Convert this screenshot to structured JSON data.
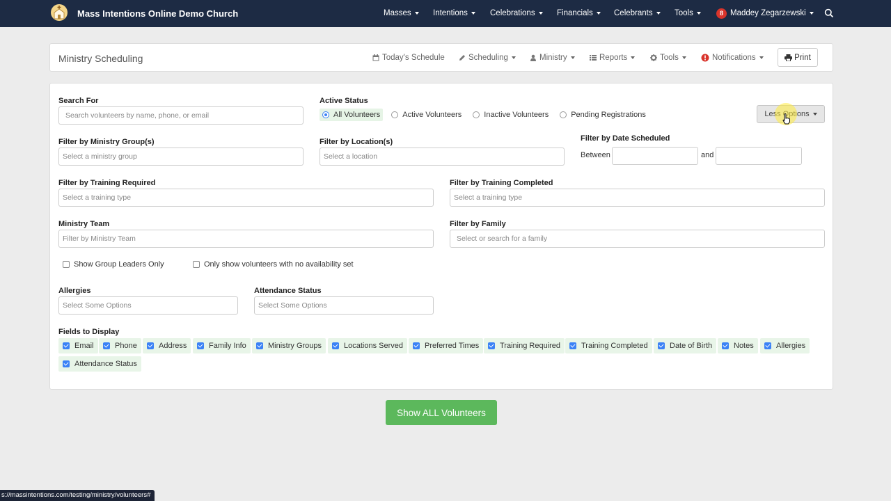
{
  "navbar": {
    "brand": "Mass Intentions Online Demo Church",
    "items": [
      {
        "label": "Masses"
      },
      {
        "label": "Intentions"
      },
      {
        "label": "Celebrations"
      },
      {
        "label": "Financials"
      },
      {
        "label": "Celebrants"
      },
      {
        "label": "Tools"
      }
    ],
    "notification_count": "8",
    "user_name": "Maddey Zegarzewski",
    "logo_icon": "church-logo-icon",
    "search_icon": "search-icon"
  },
  "header": {
    "title": "Ministry Scheduling",
    "menu": [
      {
        "label": "Today's Schedule",
        "icon": "calendar-icon"
      },
      {
        "label": "Scheduling",
        "icon": "pencil-icon"
      },
      {
        "label": "Ministry",
        "icon": "user-icon"
      },
      {
        "label": "Reports",
        "icon": "list-icon"
      },
      {
        "label": "Tools",
        "icon": "gear-icon"
      },
      {
        "label": "Notifications",
        "icon": "alert-icon"
      }
    ],
    "print_label": "Print"
  },
  "filters": {
    "search": {
      "label": "Search For",
      "placeholder": "Search volunteers by name, phone, or email"
    },
    "active_status": {
      "label": "Active Status",
      "options": [
        "All Volunteers",
        "Active Volunteers",
        "Inactive Volunteers",
        "Pending Registrations"
      ],
      "selected": "All Volunteers"
    },
    "less_options_label": "Less Options",
    "ministry_group": {
      "label": "Filter by Ministry Group(s)",
      "placeholder": "Select a ministry group"
    },
    "location": {
      "label": "Filter by Location(s)",
      "placeholder": "Select a location"
    },
    "date_scheduled": {
      "label": "Filter by Date Scheduled",
      "between": "Between",
      "and": "and",
      "from": "",
      "to": ""
    },
    "training_required": {
      "label": "Filter by Training Required",
      "placeholder": "Select a training type"
    },
    "training_completed": {
      "label": "Filter by Training Completed",
      "placeholder": "Select a training type"
    },
    "ministry_team": {
      "label": "Ministry Team",
      "placeholder": "Filter by Ministry Team"
    },
    "family": {
      "label": "Filter by Family",
      "placeholder": "Select or search for a family"
    },
    "show_group_leaders": {
      "label": "Show Group Leaders Only",
      "checked": false
    },
    "no_availability": {
      "label": "Only show volunteers with no availability set",
      "checked": false
    },
    "allergies": {
      "label": "Allergies",
      "placeholder": "Select Some Options"
    },
    "attendance_status": {
      "label": "Attendance Status",
      "placeholder": "Select Some Options"
    },
    "fields_to_display": {
      "label": "Fields to Display",
      "fields": [
        "Email",
        "Phone",
        "Address",
        "Family Info",
        "Ministry Groups",
        "Locations Served",
        "Preferred Times",
        "Training Required",
        "Training Completed",
        "Date of Birth",
        "Notes",
        "Allergies",
        "Attendance Status"
      ],
      "all_checked": true
    }
  },
  "show_all_label": "Show ALL Volunteers",
  "status_url": "s://massintentions.com/testing/ministry/volunteers#",
  "colors": {
    "navbar": "#1d2b44",
    "accent": "#3b82f6",
    "success": "#5cb85c",
    "badge": "#d9342b",
    "chip": "#e8f5e8"
  }
}
